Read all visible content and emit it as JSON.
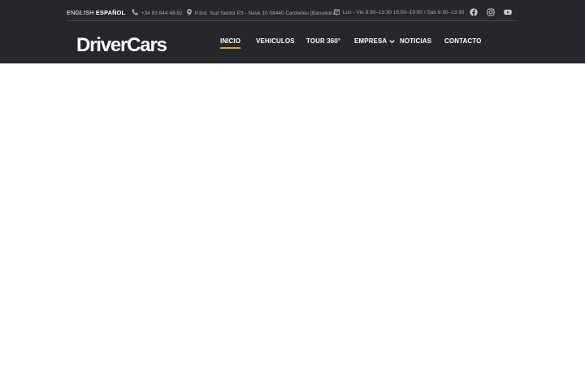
{
  "topbar": {
    "languages": [
      {
        "label": "ENGLISH",
        "active": false
      },
      {
        "label": "ESPAÑOL",
        "active": true
      }
    ],
    "phone": "+34 93 844 48 82",
    "address": "P.Ind. Sud Sector P3 - Nave 10 08440 Cardedeu (Barcelona)",
    "hours": "Lun - Vie 9:30–13:30 15:00–19:00 / Sab 9:30–13:30",
    "icons": {
      "phone": "phone-icon",
      "address": "map-marker-icon",
      "hours": "calendar-icon"
    },
    "social": [
      "facebook-icon",
      "instagram-icon",
      "youtube-icon"
    ]
  },
  "brand": {
    "logo_text": "DriverCars"
  },
  "nav": {
    "items": [
      {
        "label": "INICIO",
        "active": true
      },
      {
        "label": "VEHICULOS"
      },
      {
        "label": "TOUR 360°"
      },
      {
        "label": "EMPRESA",
        "has_dropdown": true
      },
      {
        "label": "NOTICIAS"
      },
      {
        "label": "CONTACTO"
      }
    ]
  },
  "colors": {
    "header_bg": "#25272b",
    "accent": "#e0a42b",
    "text": "#ffffff",
    "muted": "#a7a9ad"
  }
}
